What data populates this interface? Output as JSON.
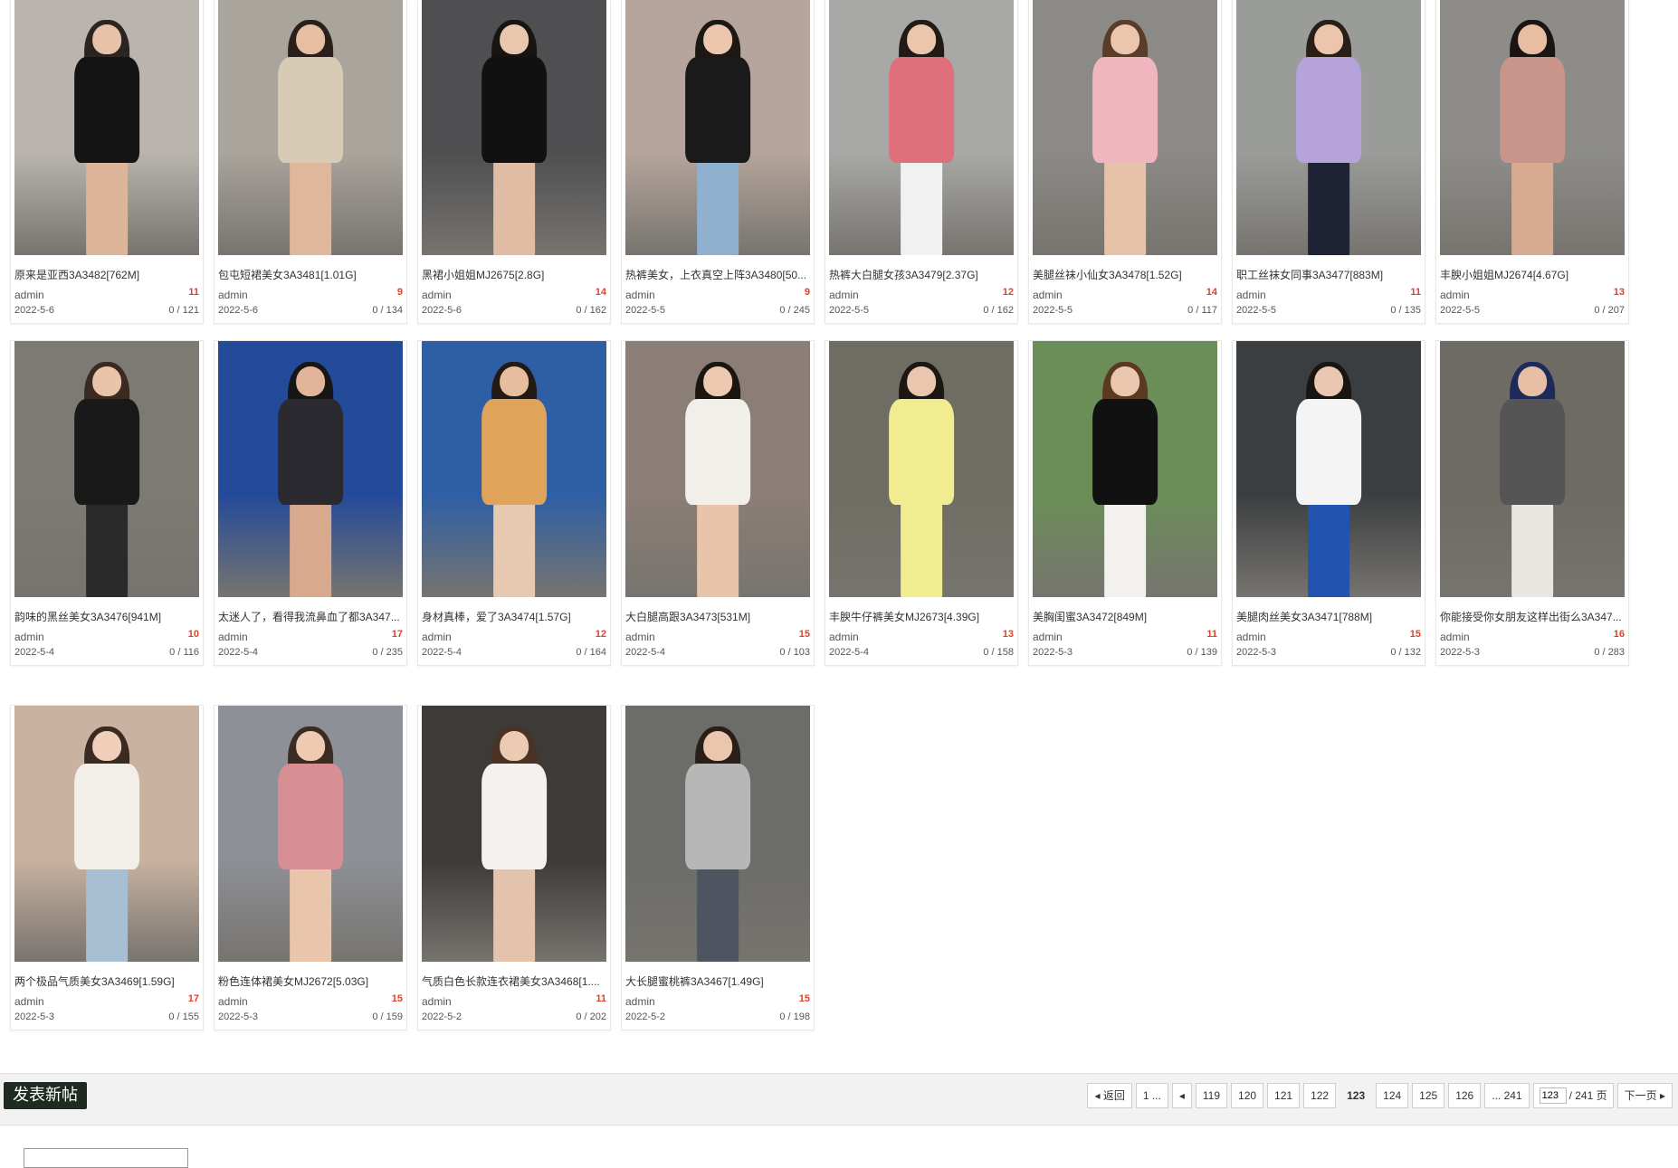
{
  "posts": [
    {
      "title": "原来是亚西3A3482[762M]",
      "author": "admin",
      "count": "11",
      "date": "2022-5-6",
      "stats": "0 / 121"
    },
    {
      "title": "包屯短裙美女3A3481[1.01G]",
      "author": "admin",
      "count": "9",
      "date": "2022-5-6",
      "stats": "0 / 134"
    },
    {
      "title": "黑裙小姐姐MJ2675[2.8G]",
      "author": "admin",
      "count": "14",
      "date": "2022-5-6",
      "stats": "0 / 162"
    },
    {
      "title": "热裤美女，上衣真空上阵3A3480[50...",
      "author": "admin",
      "count": "9",
      "date": "2022-5-5",
      "stats": "0 / 245"
    },
    {
      "title": "热裤大白腿女孩3A3479[2.37G]",
      "author": "admin",
      "count": "12",
      "date": "2022-5-5",
      "stats": "0 / 162"
    },
    {
      "title": "美腿丝袜小仙女3A3478[1.52G]",
      "author": "admin",
      "count": "14",
      "date": "2022-5-5",
      "stats": "0 / 117"
    },
    {
      "title": "职工丝袜女同事3A3477[883M]",
      "author": "admin",
      "count": "11",
      "date": "2022-5-5",
      "stats": "0 / 135"
    },
    {
      "title": "丰腴小姐姐MJ2674[4.67G]",
      "author": "admin",
      "count": "13",
      "date": "2022-5-5",
      "stats": "0 / 207"
    },
    {
      "title": "韵味的黑丝美女3A3476[941M]",
      "author": "admin",
      "count": "10",
      "date": "2022-5-4",
      "stats": "0 / 116"
    },
    {
      "title": "太迷人了，看得我流鼻血了都3A347...",
      "author": "admin",
      "count": "17",
      "date": "2022-5-4",
      "stats": "0 / 235"
    },
    {
      "title": "身材真棒，爱了3A3474[1.57G]",
      "author": "admin",
      "count": "12",
      "date": "2022-5-4",
      "stats": "0 / 164"
    },
    {
      "title": "大白腿高跟3A3473[531M]",
      "author": "admin",
      "count": "15",
      "date": "2022-5-4",
      "stats": "0 / 103"
    },
    {
      "title": "丰腴牛仔裤美女MJ2673[4.39G]",
      "author": "admin",
      "count": "13",
      "date": "2022-5-4",
      "stats": "0 / 158"
    },
    {
      "title": "美胸闺蜜3A3472[849M]",
      "author": "admin",
      "count": "11",
      "date": "2022-5-3",
      "stats": "0 / 139"
    },
    {
      "title": "美腿肉丝美女3A3471[788M]",
      "author": "admin",
      "count": "15",
      "date": "2022-5-3",
      "stats": "0 / 132"
    },
    {
      "title": "你能接受你女朋友这样出街么3A347...",
      "author": "admin",
      "count": "16",
      "date": "2022-5-3",
      "stats": "0 / 283"
    },
    {
      "title": "两个极品气质美女3A3469[1.59G]",
      "author": "admin",
      "count": "17",
      "date": "2022-5-3",
      "stats": "0 / 155"
    },
    {
      "title": "粉色连体裙美女MJ2672[5.03G]",
      "author": "admin",
      "count": "15",
      "date": "2022-5-3",
      "stats": "0 / 159"
    },
    {
      "title": "气质白色长款连衣裙美女3A3468[1....",
      "author": "admin",
      "count": "11",
      "date": "2022-5-2",
      "stats": "0 / 202"
    },
    {
      "title": "大长腿蜜桃裤3A3467[1.49G]",
      "author": "admin",
      "count": "15",
      "date": "2022-5-2",
      "stats": "0 / 198"
    }
  ],
  "thumb_palettes": [
    {
      "bg": "#b9b4ae",
      "hair": "#2b2522",
      "skin": "#e8c2a8",
      "body": "#141414",
      "legs": "#dcb59b"
    },
    {
      "bg": "#a9a49c",
      "hair": "#2a1f1a",
      "skin": "#e6bfa3",
      "body": "#d8cbb5",
      "legs": "#dfb79d"
    },
    {
      "bg": "#4f4f51",
      "hair": "#171411",
      "skin": "#e9c6ae",
      "body": "#111111",
      "legs": "#e0bca4"
    },
    {
      "bg": "#b5a59c",
      "hair": "#1e1814",
      "skin": "#ecc7ae",
      "body": "#1a1a1a",
      "legs": "#8fb0cf"
    },
    {
      "bg": "#a8a8a6",
      "hair": "#221a16",
      "skin": "#ebc6ad",
      "body": "#de6f7b",
      "legs": "#f1f1f1"
    },
    {
      "bg": "#8c8a86",
      "hair": "#5a3c2b",
      "skin": "#ecc6ac",
      "body": "#efb6c0",
      "legs": "#e7c1a8"
    },
    {
      "bg": "#9a9c9a",
      "hair": "#2a1e19",
      "skin": "#ebc6ad",
      "body": "#b6a3d9",
      "legs": "#1e2435"
    },
    {
      "bg": "#8d8c88",
      "hair": "#1a1512",
      "skin": "#e7bea2",
      "body": "#c9958a",
      "legs": "#d8aa92"
    },
    {
      "bg": "#7d7a74",
      "hair": "#3b2a22",
      "skin": "#e9c3aa",
      "body": "#191919",
      "legs": "#2a2a2a"
    },
    {
      "bg": "#244a9a",
      "hair": "#161616",
      "skin": "#e2b59b",
      "body": "#2a2a30",
      "legs": "#d9a98e"
    },
    {
      "bg": "#2e5fa5",
      "hair": "#241a14",
      "skin": "#e7bd9f",
      "body": "#e0a35a",
      "legs": "#e7c8b0"
    },
    {
      "bg": "#8b7e76",
      "hair": "#1c1611",
      "skin": "#edc9b1",
      "body": "#f1efea",
      "legs": "#e8c4ab"
    },
    {
      "bg": "#6f6d63",
      "hair": "#1d1713",
      "skin": "#ebc6ae",
      "body": "#f0ec8f",
      "legs": "#f0ec8f"
    },
    {
      "bg": "#6b8e58",
      "hair": "#5b3a24",
      "skin": "#ecc7af",
      "body": "#111111",
      "legs": "#f2f1ee"
    },
    {
      "bg": "#3b3e40",
      "hair": "#181513",
      "skin": "#eac7b0",
      "body": "#f4f4f4",
      "legs": "#2353b0"
    },
    {
      "bg": "#6e6a64",
      "hair": "#1e2a5a",
      "skin": "#e6bfa5",
      "body": "#555555",
      "legs": "#e8e6e0"
    },
    {
      "bg": "#c9b2a0",
      "hair": "#3a2a22",
      "skin": "#f0cfba",
      "body": "#f1efe8",
      "legs": "#a7bfd3"
    },
    {
      "bg": "#8d9096",
      "hair": "#3a2c22",
      "skin": "#eecab3",
      "body": "#d88f93",
      "legs": "#e9c5ac"
    },
    {
      "bg": "#3d3a38",
      "hair": "#4a3325",
      "skin": "#eccbb5",
      "body": "#f3f2ef",
      "legs": "#e3c3ab"
    },
    {
      "bg": "#6c6c68",
      "hair": "#2a1e18",
      "skin": "#eac6ad",
      "body": "#b7b7b7",
      "legs": "#4e5560"
    }
  ],
  "actions": {
    "new_post": "发表新帖"
  },
  "pagination": {
    "back": "返回",
    "first": "1 ...",
    "pages": [
      "119",
      "120",
      "121",
      "122",
      "123",
      "124",
      "125",
      "126"
    ],
    "current": "123",
    "last": "... 241",
    "input_value": "123",
    "total": "/ 241 页",
    "next": "下一页"
  },
  "colors": {
    "accent_red": "#e0402b",
    "new_post_bg": "#1f2a20"
  }
}
